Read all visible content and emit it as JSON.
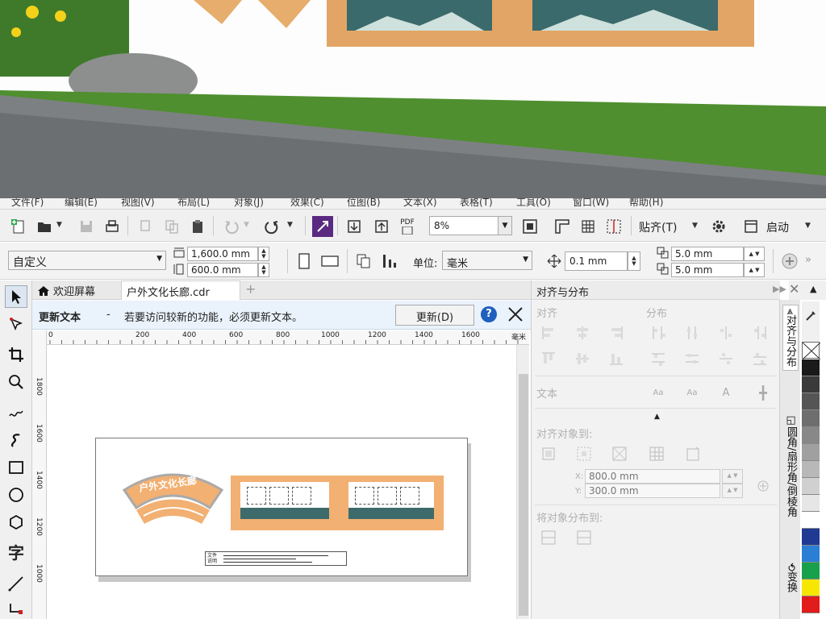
{
  "menu": {
    "items": [
      "文件(F)",
      "编辑(E)",
      "视图(V)",
      "布局(L)",
      "对象(J)",
      "效果(C)",
      "位图(B)",
      "文本(X)",
      "表格(T)",
      "工具(O)",
      "窗口(W)",
      "帮助(H)"
    ]
  },
  "toolbar": {
    "zoom_value": "8%",
    "pdf_label": "PDF",
    "snap_label": "贴齐(T)",
    "launch_label": "启动"
  },
  "property_bar": {
    "page_preset": "自定义",
    "width": "1,600.0 mm",
    "height": "600.0 mm",
    "units_label": "单位:",
    "units_value": "毫米",
    "nudge": "0.1 mm",
    "dup_x": "5.0 mm",
    "dup_y": "5.0 mm"
  },
  "tabs": {
    "welcome": "欢迎屏幕",
    "document": "户外文化长廊.cdr",
    "add": "+"
  },
  "notice": {
    "title": "更新文本",
    "dash": "-",
    "message": "若要访问较新的功能，必须更新文本。",
    "button": "更新(D)"
  },
  "ruler": {
    "h_ticks": [
      "0",
      "200",
      "400",
      "600",
      "800",
      "1000",
      "1200",
      "1400",
      "1600"
    ],
    "unit": "毫米",
    "v_ticks": [
      "1800",
      "1600",
      "1400",
      "1200",
      "1000"
    ]
  },
  "design": {
    "arch_text": "户外文化长廊",
    "note_label": "文件说明"
  },
  "docker": {
    "title": "对齐与分布",
    "align_section": "对齐",
    "distribute_section": "分布",
    "text_section": "文本",
    "align_to": "对齐对象到:",
    "x_label": "X:",
    "x_value": "800.0 mm",
    "y_label": "Y:",
    "y_value": "300.0 mm",
    "distribute_to": "将对象分布到:"
  },
  "side_tabs": {
    "align": "对齐与分布",
    "fillet": "圆角/扇形角/倒棱角",
    "transform": "变换"
  },
  "colors": {
    "accent_orange": "#f2b072",
    "panel_teal": "#3d6b6b",
    "palette": [
      "#1a1a1a",
      "#3a3a3a",
      "#555555",
      "#6e6e6e",
      "#888888",
      "#a0a0a0",
      "#b8b8b8",
      "#d0d0d0",
      "#e6e6e6",
      "#ffffff",
      "#1f3a93",
      "#2a7fd4",
      "#18a14a",
      "#f7e600",
      "#e21b1b"
    ]
  }
}
